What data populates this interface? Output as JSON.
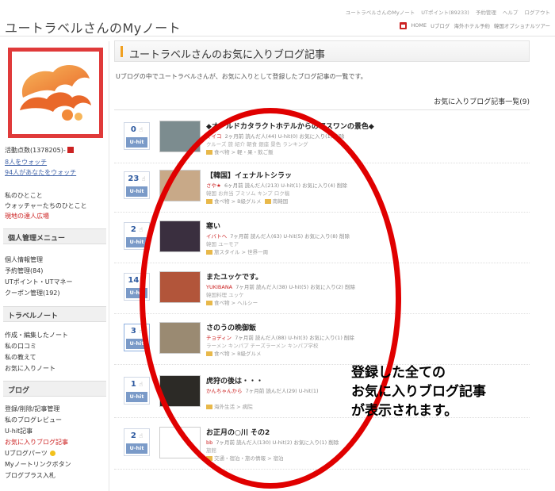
{
  "header": {
    "site_title": "ユートラベルさんのMyノート",
    "util_links": [
      "ユートラベルさんのMyノート",
      "UTポイント(89233)",
      "予約管理",
      "ヘルプ",
      "ログアウト"
    ],
    "main_links": [
      "HOME",
      "Uブログ",
      "海外ホテル予約",
      "韓国オプショナルツアー"
    ]
  },
  "sidebar": {
    "activity_points": "活動点数(1378205)-",
    "watching": "8人をウォッチ",
    "watchers": "94人があなたをウォッチ",
    "links_top": [
      "私のひとこと",
      "ウォッチャーたちのひとこと"
    ],
    "link_red": "現地の達人広場",
    "personal_heading": "個人管理メニュー",
    "personal_items": [
      "個人情報管理",
      "予約管理(84)",
      "UTポイント・UTマネー",
      "クーポン管理(192)"
    ],
    "travel_heading": "トラベルノート",
    "travel_items": [
      "作成・編集したノート",
      "私の口コミ",
      "私の教えて",
      "お気に入りノート"
    ],
    "blog_heading": "ブログ",
    "blog_items": [
      "登録/削除/記事管理",
      "私のブログレビュー",
      "U-hit記事"
    ],
    "blog_active": "お気に入りブログ記事",
    "blog_items_after": [
      "Uブログパーツ",
      "Myノートリンクボタン",
      "ブログプラス入札"
    ]
  },
  "main": {
    "heading": "ユートラベルさんのお気に入りブログ記事",
    "description": "Uブログの中でユートラベルさんが、お気に入りとして登録したブログ記事の一覧です。",
    "list_title": "お気に入りブログ記事一覧(9)"
  },
  "posts": [
    {
      "hits": "0",
      "hit_label": "U-hit",
      "title": "◆オールドカタラクトホテルからのアスワンの景色◆",
      "author": "マイコ",
      "meta": "2ヶ月前  読んだ人(44)  U-hit(0)  お気に入り(1)  削除",
      "tags": "クルーズ  旅  紹介  朝食  銀座  景色  ランキング",
      "category": "食べ物 > 軽・果・飲ご飯",
      "thumb": "#7c8c8f"
    },
    {
      "hits": "23",
      "hit_label": "U-hit",
      "title": "【韓国】イェナルトシラッ",
      "author": "さや★",
      "meta": "6ヶ月前  読んだ人(213)  U-hit(1)  お気に入り(4)  削除",
      "tags": "韓国  お弁当  プミソム  キンプ  ロク稿",
      "category": "食べ物 > B級グルメ",
      "extra": "南韓国",
      "thumb": "#c8a988"
    },
    {
      "hits": "2",
      "hit_label": "U-hit",
      "title": "寒い",
      "author": "イバトヘ",
      "meta": "7ヶ月前  読んだ人(63)  U-hit(5)  お気に入り(8)  削除",
      "tags": "韓国  ユーモア",
      "category": "旅スタイル > 世界一周",
      "thumb": "#3a2f3f"
    },
    {
      "hits": "14",
      "hit_label": "U-hit",
      "title": "またユッケです。",
      "author": "YUKIBANA",
      "meta": "7ヶ月前  読んだ人(38)  U-hit(5)  お気に入り(2)  削除",
      "tags": "韓国料理  ユッケ",
      "category": "食べ物 > ヘルシー",
      "thumb": "#b2553a"
    },
    {
      "hits": "3",
      "hit_label": "U-hit",
      "title": "さのうの晩御飯",
      "author": "チョディン",
      "meta": "7ヶ月前  読んだ人(88)  U-hit(3)  お気に入り(1)  削除",
      "tags": "ラーメン  キンパプ  チーズラーメン  キンパプ学校",
      "category": "食べ物 > B級グルメ",
      "thumb": "#9a8a72"
    },
    {
      "hits": "1",
      "hit_label": "U-hit",
      "title": "虎狩の後は・・・",
      "author": "かんちゃんから",
      "meta": "7ヶ月前  読んだ人(29)  U-hit(1)",
      "tags": "",
      "category": "海外生活 > 病院",
      "thumb": "#2c2a26"
    },
    {
      "hits": "2",
      "hit_label": "U-hit",
      "title": "お正月の○川  その2",
      "author": "bb",
      "meta": "7ヶ月前  読んだ人(130)  U-hit(2)  お気に入り(1)  削除",
      "tags": "旅館",
      "category": "交通・宿泊・旅の情報 > 宿泊",
      "thumb": "#ffffff"
    }
  ],
  "annotation": {
    "lines": [
      "登録した全ての",
      "お気に入りブログ記事",
      "が表示されます。"
    ],
    "color": "#e00000"
  }
}
